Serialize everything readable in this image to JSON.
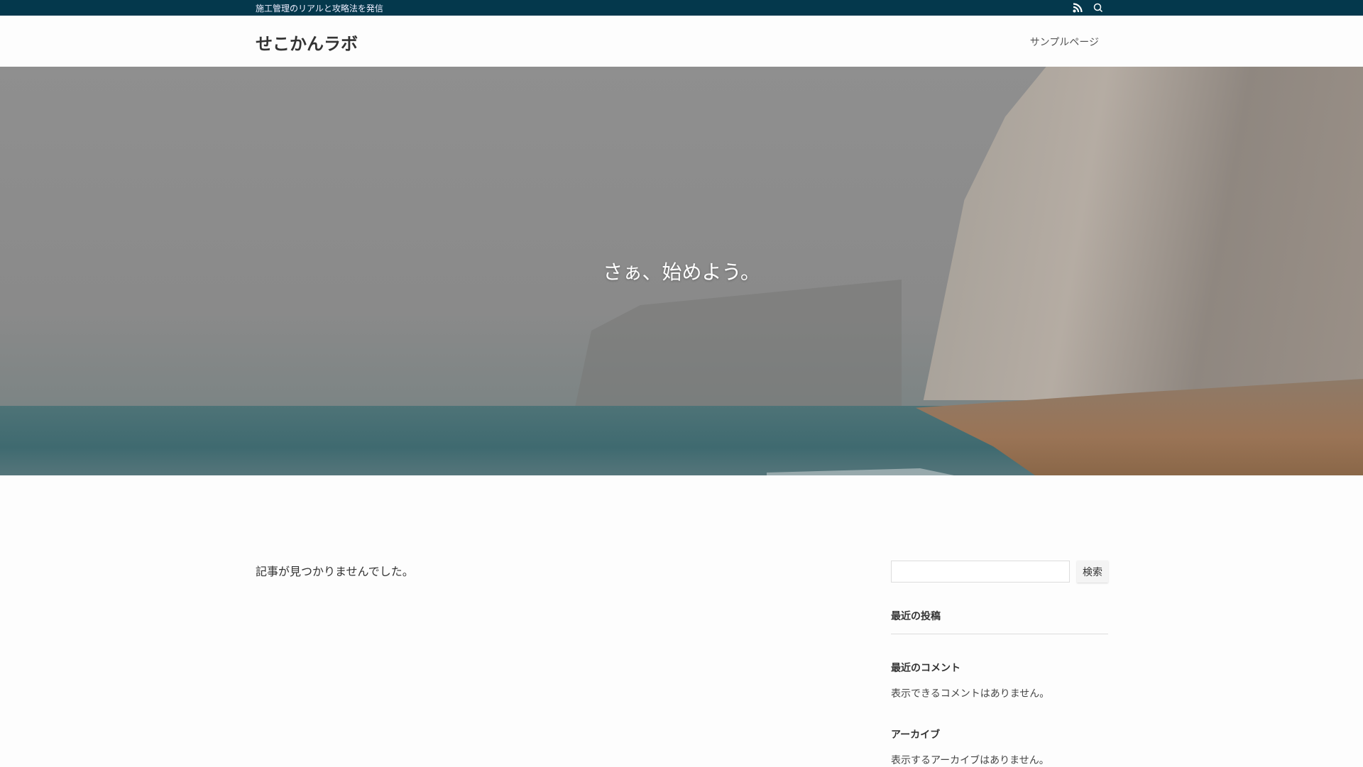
{
  "topbar": {
    "tagline": "施工管理のリアルと攻略法を発信",
    "icons": [
      "rss-icon",
      "search-icon"
    ]
  },
  "header": {
    "site_title": "せこかんラボ",
    "nav": [
      {
        "label": "サンプルページ"
      }
    ]
  },
  "hero": {
    "caption": "さぁ、始めよう。"
  },
  "main": {
    "message": "記事が見つかりませんでした。"
  },
  "sidebar": {
    "search": {
      "value": "",
      "button": "検索"
    },
    "recent_posts": {
      "title": "最近の投稿"
    },
    "recent_comments": {
      "title": "最近のコメント",
      "empty": "表示できるコメントはありません。"
    },
    "archives": {
      "title": "アーカイブ",
      "empty": "表示するアーカイブはありません。"
    }
  },
  "colors": {
    "topbar": "#04384c"
  }
}
